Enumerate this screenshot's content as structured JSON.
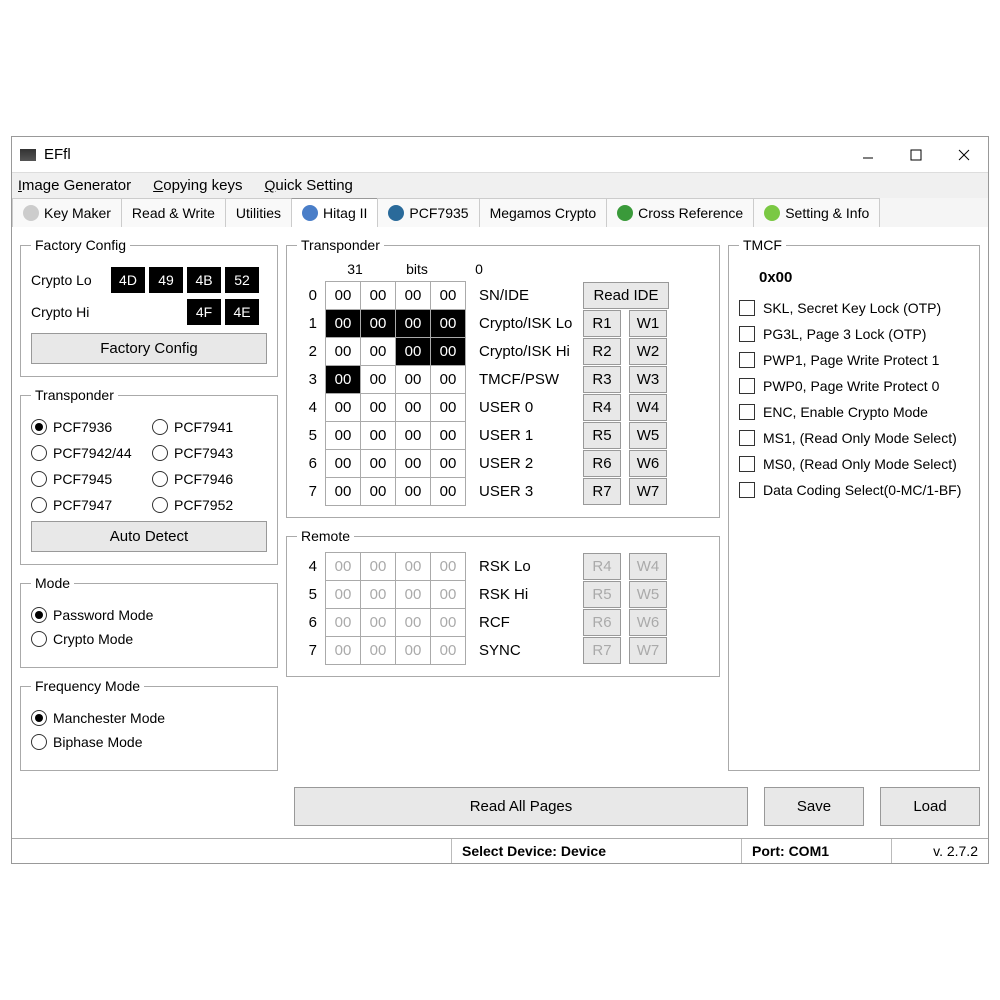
{
  "window": {
    "title": "EFfl"
  },
  "menus": [
    "Image Generator",
    "Copying keys",
    "Quick Setting"
  ],
  "tabs": [
    {
      "label": "Key Maker",
      "icon": "#ccc"
    },
    {
      "label": "Read & Write",
      "icon": ""
    },
    {
      "label": "Utilities",
      "icon": ""
    },
    {
      "label": "Hitag II",
      "icon": "#4a7ec8",
      "active": true
    },
    {
      "label": "PCF7935",
      "icon": "#2a6a9a"
    },
    {
      "label": "Megamos Crypto",
      "icon": ""
    },
    {
      "label": "Cross Reference",
      "icon": "#3a9a3a"
    },
    {
      "label": "Setting & Info",
      "icon": "#7ac843"
    }
  ],
  "factory": {
    "title": "Factory Config",
    "lo_label": "Crypto Lo",
    "lo": [
      "4D",
      "49",
      "4B",
      "52"
    ],
    "hi_label": "Crypto Hi",
    "hi": [
      "4F",
      "4E"
    ],
    "btn": "Factory Config"
  },
  "tconfig": {
    "title": "Transponder",
    "options": [
      "PCF7936",
      "PCF7941",
      "PCF7942/44",
      "PCF7943",
      "PCF7945",
      "PCF7946",
      "PCF7947",
      "PCF7952"
    ],
    "selected": "PCF7936",
    "btn": "Auto Detect"
  },
  "mode": {
    "title": "Mode",
    "options": [
      "Password Mode",
      "Crypto Mode"
    ],
    "selected": "Password Mode"
  },
  "freq": {
    "title": "Frequency Mode",
    "options": [
      "Manchester Mode",
      "Biphase Mode"
    ],
    "selected": "Manchester Mode"
  },
  "tdata": {
    "title": "Transponder",
    "hdr": [
      "31",
      "bits",
      "0"
    ],
    "rows": [
      {
        "i": "0",
        "c": [
          {
            "v": "00"
          },
          {
            "v": "00"
          },
          {
            "v": "00"
          },
          {
            "v": "00"
          }
        ],
        "lbl": "SN/IDE",
        "r": "Read IDE",
        "w": ""
      },
      {
        "i": "1",
        "c": [
          {
            "v": "00",
            "inv": 1
          },
          {
            "v": "00",
            "inv": 1
          },
          {
            "v": "00",
            "inv": 1
          },
          {
            "v": "00",
            "inv": 1
          }
        ],
        "lbl": "Crypto/ISK Lo",
        "r": "R1",
        "w": "W1"
      },
      {
        "i": "2",
        "c": [
          {
            "v": "00"
          },
          {
            "v": "00"
          },
          {
            "v": "00",
            "inv": 1
          },
          {
            "v": "00",
            "inv": 1
          }
        ],
        "lbl": "Crypto/ISK Hi",
        "r": "R2",
        "w": "W2"
      },
      {
        "i": "3",
        "c": [
          {
            "v": "00",
            "inv": 1
          },
          {
            "v": "00"
          },
          {
            "v": "00"
          },
          {
            "v": "00"
          }
        ],
        "lbl": "TMCF/PSW",
        "r": "R3",
        "w": "W3"
      },
      {
        "i": "4",
        "c": [
          {
            "v": "00"
          },
          {
            "v": "00"
          },
          {
            "v": "00"
          },
          {
            "v": "00"
          }
        ],
        "lbl": "USER 0",
        "r": "R4",
        "w": "W4"
      },
      {
        "i": "5",
        "c": [
          {
            "v": "00"
          },
          {
            "v": "00"
          },
          {
            "v": "00"
          },
          {
            "v": "00"
          }
        ],
        "lbl": "USER 1",
        "r": "R5",
        "w": "W5"
      },
      {
        "i": "6",
        "c": [
          {
            "v": "00"
          },
          {
            "v": "00"
          },
          {
            "v": "00"
          },
          {
            "v": "00"
          }
        ],
        "lbl": "USER 2",
        "r": "R6",
        "w": "W6"
      },
      {
        "i": "7",
        "c": [
          {
            "v": "00"
          },
          {
            "v": "00"
          },
          {
            "v": "00"
          },
          {
            "v": "00"
          }
        ],
        "lbl": "USER 3",
        "r": "R7",
        "w": "W7"
      }
    ]
  },
  "remote": {
    "title": "Remote",
    "rows": [
      {
        "i": "4",
        "c": [
          "00",
          "00",
          "00",
          "00"
        ],
        "lbl": "RSK Lo",
        "r": "R4",
        "w": "W4"
      },
      {
        "i": "5",
        "c": [
          "00",
          "00",
          "00",
          "00"
        ],
        "lbl": "RSK Hi",
        "r": "R5",
        "w": "W5"
      },
      {
        "i": "6",
        "c": [
          "00",
          "00",
          "00",
          "00"
        ],
        "lbl": "RCF",
        "r": "R6",
        "w": "W6"
      },
      {
        "i": "7",
        "c": [
          "00",
          "00",
          "00",
          "00"
        ],
        "lbl": "SYNC",
        "r": "R7",
        "w": "W7"
      }
    ]
  },
  "tmcf": {
    "title": "TMCF",
    "value": "0x00",
    "flags": [
      "SKL, Secret Key Lock (OTP)",
      "PG3L, Page 3 Lock (OTP)",
      "PWP1, Page Write Protect 1",
      "PWP0, Page Write Protect 0",
      "ENC, Enable Crypto Mode",
      "MS1, (Read Only Mode Select)",
      "MS0, (Read Only Mode Select)",
      "Data Coding Select(0-MC/1-BF)"
    ]
  },
  "bottom": {
    "read": "Read All Pages",
    "save": "Save",
    "load": "Load"
  },
  "status": {
    "device_label": "Select Device:",
    "device": "Device",
    "port_label": "Port:",
    "port": "COM1",
    "ver": "v. 2.7.2"
  }
}
